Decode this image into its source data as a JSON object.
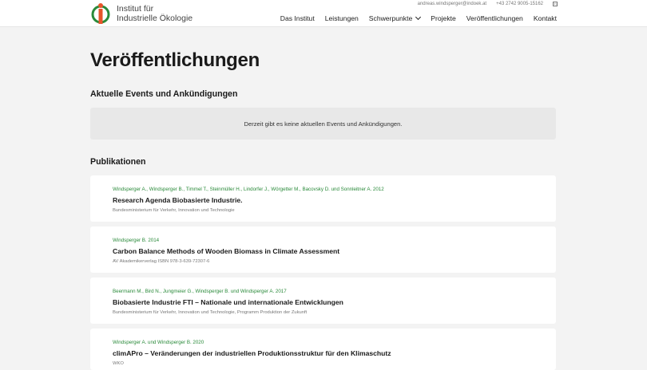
{
  "header": {
    "logo_line1": "Institut für",
    "logo_line2": "Industrielle Ökologie",
    "email": "andreas.windsperger@indoek.at",
    "phone": "+43 2742 9005-15162",
    "social_icon": "linkedin-icon",
    "nav": [
      {
        "label": "Das Institut"
      },
      {
        "label": "Leistungen"
      },
      {
        "label": "Schwerpunkte"
      },
      {
        "label": "Projekte"
      },
      {
        "label": "Veröffentlichungen"
      },
      {
        "label": "Kontakt"
      }
    ],
    "colors": {
      "accent_green": "#2a8a3a",
      "accent_orange": "#e8542a"
    }
  },
  "page": {
    "title": "Veröffentlichungen",
    "events_heading": "Aktuelle Events und Ankündigungen",
    "events_empty": "Derzeit gibt es keine aktuellen Events und Ankündigungen.",
    "publications_heading": "Publikationen"
  },
  "publications": [
    {
      "authors": "Windsperger A., Windsperger B., Timmel T., Steinmüller H., Lindorfer J., Wörgetter M., Bacovsky D. und Sonnleitner A. 2012",
      "title": "Research Agenda Biobasierte Industrie.",
      "publisher": "Bundesministerium für Verkehr, Innovation und Technologie"
    },
    {
      "authors": "Windsperger B. 2014",
      "title": "Carbon Balance Methods of Wooden Biomass in Climate Assessment",
      "publisher": "AV Akademikerverlag ISBN 978-3-639-72307-6"
    },
    {
      "authors": "Beermann M., Bird N., Jungmeier G., Windsperger B. und Windsperger A. 2017",
      "title": "Biobasierte Industrie FTI – Nationale und internationale Entwicklungen",
      "publisher": "Bundesministerium für Verkehr, Innovation und Technologie, Programm Produktion der Zukunft"
    },
    {
      "authors": "Windsperger A. und Windsperger B. 2020",
      "title": "climAPro – Veränderungen der industriellen Produktionsstruktur für den Klimaschutz",
      "publisher": "WKO"
    }
  ]
}
